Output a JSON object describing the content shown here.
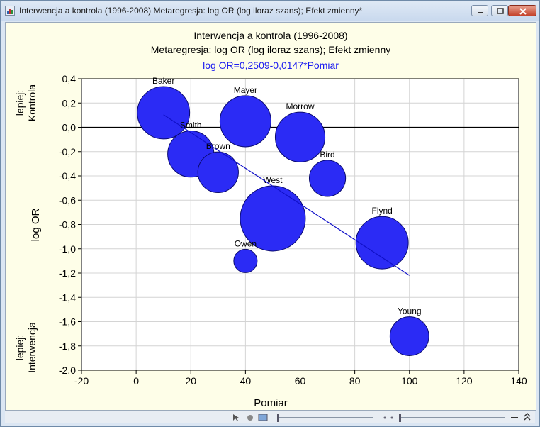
{
  "window": {
    "title": "Interwencja a kontrola (1996-2008) Metaregresja: log OR (log iloraz szans); Efekt zmienny*"
  },
  "chart_data": {
    "type": "scatter",
    "title": "Interwencja a kontrola (1996-2008)",
    "subtitle": "Metaregresja: log OR (log iloraz szans); Efekt zmienny",
    "equation": "log OR=0,2509-0,0147*Pomiar",
    "xlabel": "Pomiar",
    "ylabel": "log OR",
    "side_label_top": [
      "lepiej:",
      "Kontrola"
    ],
    "side_label_bottom": [
      "lepiej:",
      "Interwencja"
    ],
    "xlim": [
      -20,
      140
    ],
    "ylim": [
      -2.0,
      0.4
    ],
    "x_ticks": [
      "-20",
      "0",
      "20",
      "40",
      "60",
      "80",
      "100",
      "120",
      "140"
    ],
    "y_ticks": [
      "0,4",
      "0,2",
      "0,0",
      "-0,2",
      "-0,4",
      "-0,6",
      "-0,8",
      "-1,0",
      "-1,2",
      "-1,4",
      "-1,6",
      "-1,8",
      "-2,0"
    ],
    "grid": true,
    "reference_line_y": 0,
    "regression_line": {
      "intercept": 0.2509,
      "slope": -0.0147,
      "x_range": [
        10,
        100
      ]
    },
    "bubble_color": "#2b2bf5",
    "points": [
      {
        "label": "Baker",
        "x": 10,
        "y": 0.12,
        "weight": 1.0
      },
      {
        "label": "Mayer",
        "x": 40,
        "y": 0.05,
        "weight": 0.95
      },
      {
        "label": "Morrow",
        "x": 60,
        "y": -0.08,
        "weight": 0.9
      },
      {
        "label": "Smith",
        "x": 20,
        "y": -0.22,
        "weight": 0.78
      },
      {
        "label": "Brown",
        "x": 30,
        "y": -0.37,
        "weight": 0.6
      },
      {
        "label": "Bird",
        "x": 70,
        "y": -0.42,
        "weight": 0.48
      },
      {
        "label": "West",
        "x": 50,
        "y": -0.75,
        "weight": 1.55
      },
      {
        "label": "Flynd",
        "x": 90,
        "y": -0.95,
        "weight": 1.0
      },
      {
        "label": "Owen",
        "x": 40,
        "y": -1.1,
        "weight": 0.2
      },
      {
        "label": "Young",
        "x": 100,
        "y": -1.72,
        "weight": 0.55
      }
    ]
  }
}
